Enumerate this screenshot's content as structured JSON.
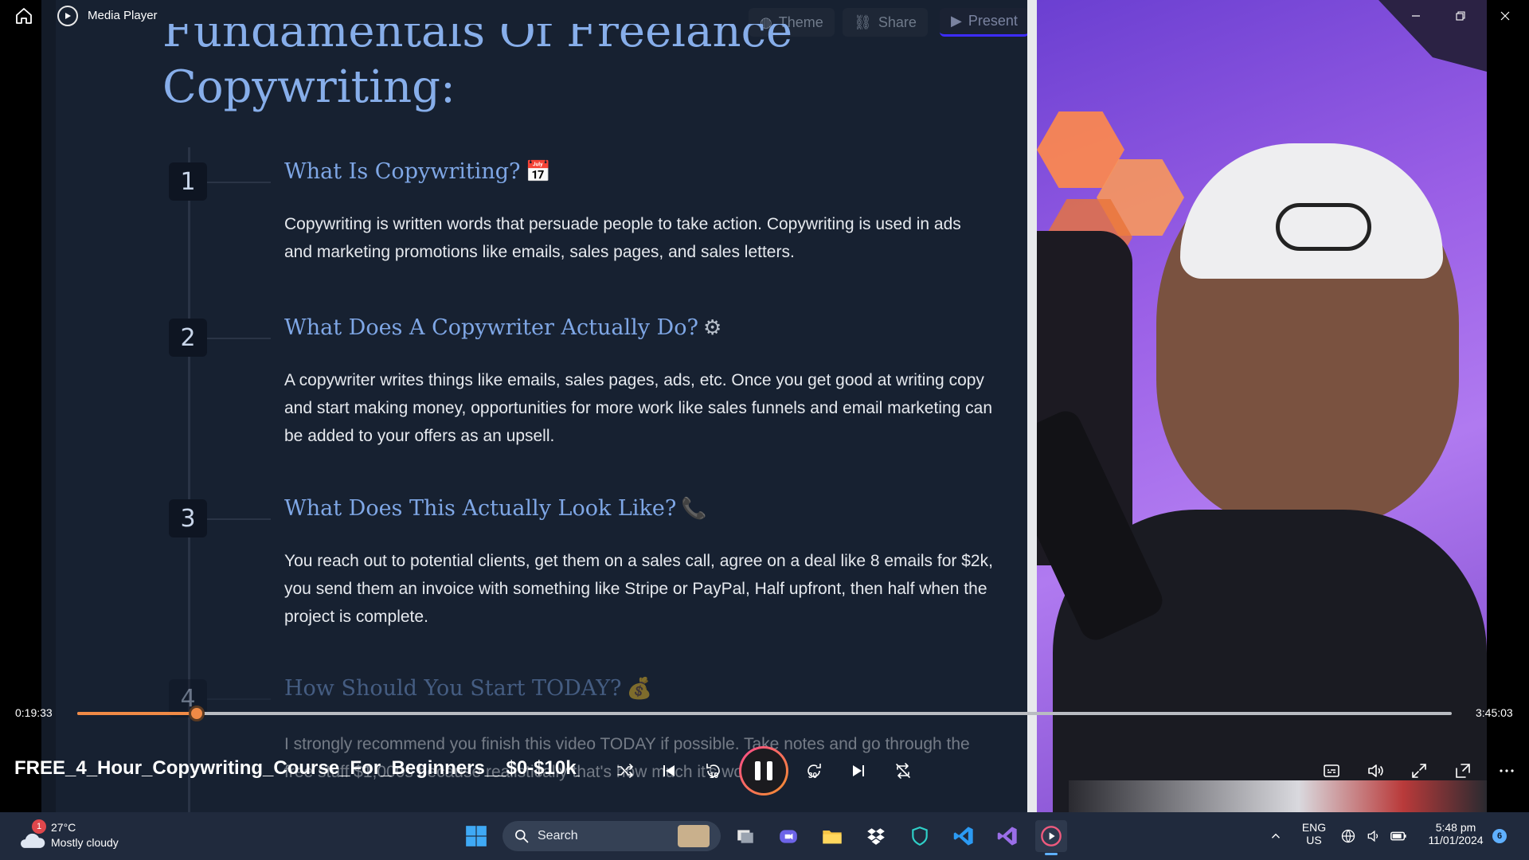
{
  "window": {
    "app_name": "Media Player",
    "home_icon": "home-icon",
    "minimize_icon": "minimize-icon",
    "restore_icon": "restore-icon",
    "close_icon": "close-icon"
  },
  "slide": {
    "title_line1": "Fundamentals Of Freelance",
    "title_line2": "Copywriting:",
    "header_buttons": {
      "theme": "Theme",
      "share": "Share",
      "present": "Present"
    },
    "steps": [
      {
        "num": "1",
        "heading": "What Is Copywriting?",
        "emoji": "📅",
        "body": "Copywriting is written words that persuade people to take action. Copywriting is used in ads and marketing promotions like emails, sales pages, and sales letters."
      },
      {
        "num": "2",
        "heading": "What Does A Copywriter Actually Do?",
        "emoji": "⚙",
        "body": "A copywriter writes things like emails, sales pages, ads, etc. Once you get good at writing copy and start making money, opportunities for more work like sales funnels and email marketing can be added to your offers as an upsell."
      },
      {
        "num": "3",
        "heading": "What Does This Actually Look Like?",
        "emoji": "📞",
        "body": "You reach out to potential clients, get them on a sales call, agree on a deal like 8 emails for $2k, you send them an invoice with something like Stripe or PayPal, Half upfront, then half when the project is complete."
      },
      {
        "num": "4",
        "heading": "How Should You Start TODAY?",
        "emoji": "💰",
        "body": "I strongly recommend you finish this video TODAY if possible. Take notes and go through the free stuff $1,000s because realistically that's how much it's worth"
      }
    ]
  },
  "player": {
    "current_time": "0:19:33",
    "total_time": "3:45:03",
    "progress": 0.087,
    "media_title": "FREE_4_Hour_Copywriting_Course_For_Beginners__$0-$10k_...",
    "controls": {
      "shuffle": "shuffle-icon",
      "previous": "previous-icon",
      "rewind_label": "10",
      "forward_label": "30",
      "next": "next-icon",
      "repeat": "repeat-icon",
      "captions": "captions-icon",
      "volume": "volume-icon",
      "fullscreen": "fullscreen-icon",
      "miniplayer": "miniplayer-icon",
      "more": "more-icon"
    },
    "accent_color": "#f08a46"
  },
  "taskbar": {
    "weather_badge": "1",
    "temperature": "27°C",
    "condition": "Mostly cloudy",
    "search_label": "Search",
    "lang_line1": "ENG",
    "lang_line2": "US",
    "time": "5:48 pm",
    "date": "11/01/2024",
    "notification_count": "6"
  }
}
